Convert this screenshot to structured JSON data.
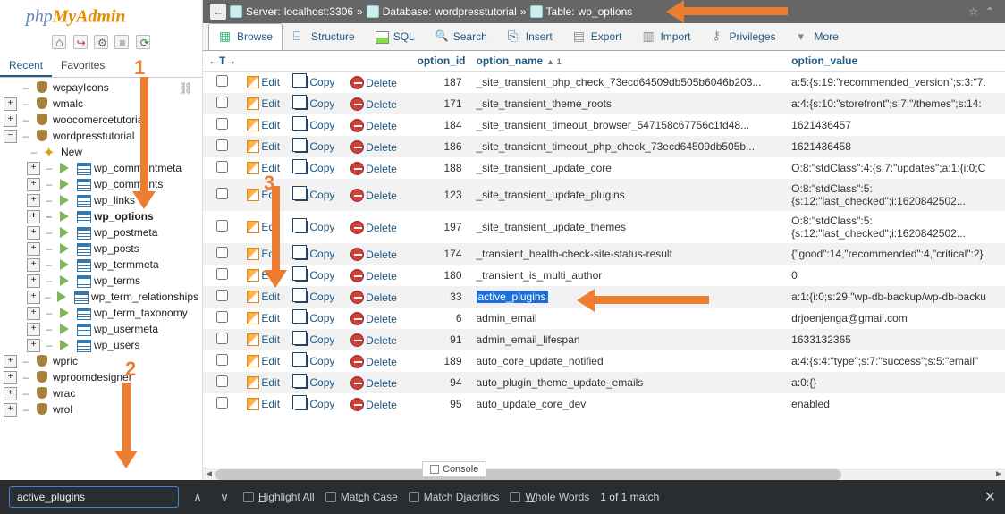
{
  "logo_alt": "phpMyAdmin",
  "sidebar": {
    "tabs": {
      "recent": "Recent",
      "favorites": "Favorites"
    },
    "databases_above": [
      {
        "name": "wcpayIcons",
        "open": false
      },
      {
        "name": "wmalc",
        "open": false,
        "expandable": true
      },
      {
        "name": "woocomercetutorial",
        "open": false,
        "expandable": true
      }
    ],
    "current_db": "wordpresstutorial",
    "new_label": "New",
    "tables": [
      "wp_commentmeta",
      "wp_comments",
      "wp_links",
      "wp_options",
      "wp_postmeta",
      "wp_posts",
      "wp_termmeta",
      "wp_terms",
      "wp_term_relationships",
      "wp_term_taxonomy",
      "wp_usermeta",
      "wp_users"
    ],
    "selected_table": "wp_options",
    "databases_below": [
      {
        "name": "wpric",
        "expandable": true
      },
      {
        "name": "wproomdesigner",
        "expandable": true
      },
      {
        "name": "wrac",
        "expandable": true
      },
      {
        "name": "wrol",
        "expandable": true
      }
    ]
  },
  "breadcrumb": {
    "server_label": "Server:",
    "server": "localhost:3306",
    "db_label": "Database:",
    "db": "wordpresstutorial",
    "table_label": "Table:",
    "table": "wp_options"
  },
  "maintabs": {
    "browse": "Browse",
    "structure": "Structure",
    "sql": "SQL",
    "search": "Search",
    "insert": "Insert",
    "export": "Export",
    "import": "Import",
    "privileges": "Privileges",
    "more": "More"
  },
  "columns": {
    "option_id": "option_id",
    "option_name": "option_name",
    "option_value": "option_value",
    "sort_indicator": "▲ 1"
  },
  "actions": {
    "edit": "Edit",
    "copy": "Copy",
    "delete": "Delete"
  },
  "rows": [
    {
      "id": 187,
      "name": "_site_transient_php_check_73ecd64509db505b6046b203...",
      "val": "a:5:{s:19:\"recommended_version\";s:3:\"7."
    },
    {
      "id": 171,
      "name": "_site_transient_theme_roots",
      "val": "a:4:{s:10:\"storefront\";s:7:\"/themes\";s:14:"
    },
    {
      "id": 184,
      "name": "_site_transient_timeout_browser_547158c67756c1fd48...",
      "val": "1621436457"
    },
    {
      "id": 186,
      "name": "_site_transient_timeout_php_check_73ecd64509db505b...",
      "val": "1621436458"
    },
    {
      "id": 188,
      "name": "_site_transient_update_core",
      "val": "O:8:\"stdClass\":4:{s:7:\"updates\";a:1:{i:0;C"
    },
    {
      "id": 123,
      "name": "_site_transient_update_plugins",
      "val": "O:8:\"stdClass\":5:\n{s:12:\"last_checked\";i:1620842502..."
    },
    {
      "id": 197,
      "name": "_site_transient_update_themes",
      "val": "O:8:\"stdClass\":5:\n{s:12:\"last_checked\";i:1620842502..."
    },
    {
      "id": 174,
      "name": "_transient_health-check-site-status-result",
      "val": "{\"good\":14,\"recommended\":4,\"critical\":2}"
    },
    {
      "id": 180,
      "name": "_transient_is_multi_author",
      "val": "0"
    },
    {
      "id": 33,
      "name": "active_plugins",
      "val": "a:1:{i:0;s:29:\"wp-db-backup/wp-db-backu",
      "highlight": true
    },
    {
      "id": 6,
      "name": "admin_email",
      "val": "drjoenjenga@gmail.com"
    },
    {
      "id": 91,
      "name": "admin_email_lifespan",
      "val": "1633132365"
    },
    {
      "id": 189,
      "name": "auto_core_update_notified",
      "val": "a:4:{s:4:\"type\";s:7:\"success\";s:5:\"email\""
    },
    {
      "id": 94,
      "name": "auto_plugin_theme_update_emails",
      "val": "a:0:{}"
    },
    {
      "id": 95,
      "name": "auto_update_core_dev",
      "val": "enabled"
    }
  ],
  "console_label": "Console",
  "findbar": {
    "value": "active_plugins",
    "highlight_all": "Highlight All",
    "match_case": "Match Case",
    "diacritics": "Match Diacritics",
    "whole_words": "Whole Words",
    "result": "1 of 1 match"
  },
  "annotations": {
    "n1": "1",
    "n2": "2",
    "n3": "3"
  }
}
